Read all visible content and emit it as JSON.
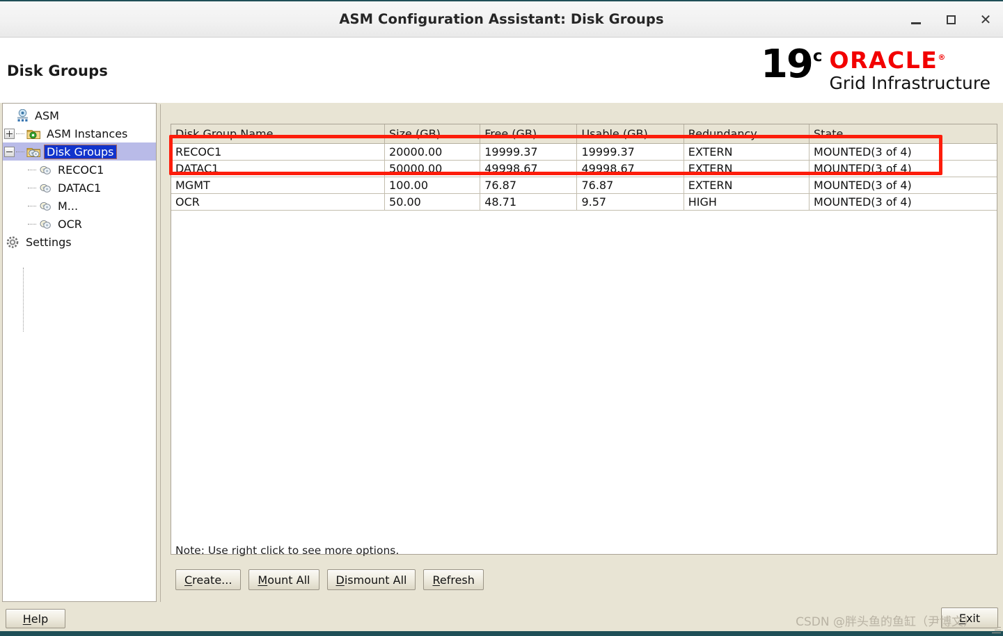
{
  "window": {
    "title": "ASM Configuration Assistant: Disk Groups",
    "minimize_label": "–",
    "maximize_label": "☐",
    "close_label": "✕"
  },
  "header": {
    "page_title": "Disk Groups",
    "brand_version": "19",
    "brand_version_sup": "c",
    "brand_oracle": "ORACLE",
    "brand_product": "Grid Infrastructure"
  },
  "sidebar": {
    "items": [
      {
        "label": "ASM",
        "icon": "asm-root-icon",
        "level": 0,
        "expander": "none",
        "selected": false
      },
      {
        "label": "ASM Instances",
        "icon": "folder-gear-icon",
        "level": 1,
        "expander": "plus",
        "selected": false
      },
      {
        "label": "Disk Groups",
        "icon": "folder-disk-icon",
        "level": 1,
        "expander": "minus",
        "selected": true
      },
      {
        "label": "RECOC1",
        "icon": "disk-icon",
        "level": 2,
        "expander": "none",
        "selected": false
      },
      {
        "label": "DATAC1",
        "icon": "disk-icon",
        "level": 2,
        "expander": "none",
        "selected": false
      },
      {
        "label": "M...",
        "icon": "disk-icon",
        "level": 2,
        "expander": "none",
        "selected": false
      },
      {
        "label": "OCR",
        "icon": "disk-icon",
        "level": 2,
        "expander": "none",
        "selected": false
      },
      {
        "label": "Settings",
        "icon": "gear-icon",
        "level": 0,
        "expander": "none",
        "selected": false
      }
    ]
  },
  "table": {
    "columns": [
      "Disk Group Name",
      "Size (GB)",
      "Free (GB)",
      "Usable (GB)",
      "Redundancy",
      "State"
    ],
    "rows": [
      {
        "name": "RECOC1",
        "size_gb": "20000.00",
        "free_gb": "19999.37",
        "usable_gb": "19999.37",
        "redundancy": "EXTERN",
        "state": "MOUNTED(3 of 4)",
        "highlighted": true
      },
      {
        "name": "DATAC1",
        "size_gb": "50000.00",
        "free_gb": "49998.67",
        "usable_gb": "49998.67",
        "redundancy": "EXTERN",
        "state": "MOUNTED(3 of 4)",
        "highlighted": true
      },
      {
        "name": "MGMT",
        "size_gb": "100.00",
        "free_gb": "76.87",
        "usable_gb": "76.87",
        "redundancy": "EXTERN",
        "state": "MOUNTED(3 of 4)",
        "highlighted": false
      },
      {
        "name": "OCR",
        "size_gb": "50.00",
        "free_gb": "48.71",
        "usable_gb": "9.57",
        "redundancy": "HIGH",
        "state": "MOUNTED(3 of 4)",
        "highlighted": false
      }
    ]
  },
  "main": {
    "note": "Note: Use right click to see more options.",
    "buttons": [
      {
        "label": "Create...",
        "mnemonic": "C"
      },
      {
        "label": "Mount All",
        "mnemonic": "M"
      },
      {
        "label": "Dismount All",
        "mnemonic": "D"
      },
      {
        "label": "Refresh",
        "mnemonic": "R"
      }
    ]
  },
  "footer": {
    "help_label": "Help",
    "help_mnemonic": "H",
    "exit_label": "Exit",
    "exit_mnemonic": "E",
    "watermark": "CSDN @胖头鱼的鱼缸（尹博文）"
  },
  "annotation": {
    "color": "#fd1d0b",
    "note": "red rectangle highlighting RECOC1 and DATAC1 rows"
  }
}
